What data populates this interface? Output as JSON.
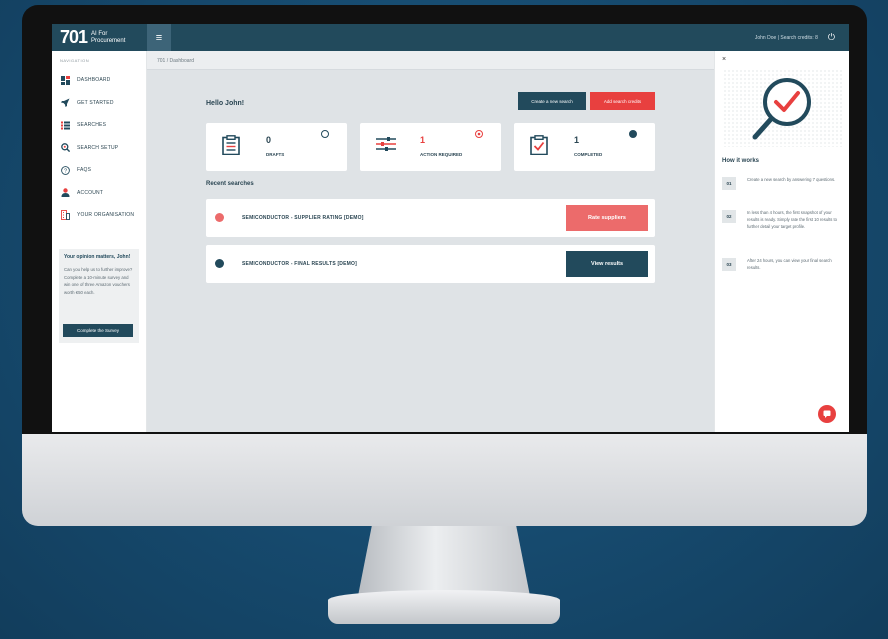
{
  "header": {
    "logo_number": "701",
    "logo_line1": "AI For",
    "logo_line2": "Procurement",
    "menu_icon": "hamburger-icon",
    "user_credits": "John Doe | Search credits: 8",
    "power_icon": "power-icon"
  },
  "sidebar": {
    "heading": "NAVIGATION",
    "items": [
      {
        "label": "DASHBOARD",
        "icon": "dashboard-icon"
      },
      {
        "label": "GET STARTED",
        "icon": "rocket-icon"
      },
      {
        "label": "SEARCHES",
        "icon": "list-icon"
      },
      {
        "label": "SEARCH SETUP",
        "icon": "search-settings-icon"
      },
      {
        "label": "FAQS",
        "icon": "question-icon"
      },
      {
        "label": "ACCOUNT",
        "icon": "user-icon"
      },
      {
        "label": "YOUR ORGANISATION",
        "icon": "building-icon"
      }
    ],
    "survey": {
      "title": "Your opinion matters, John!",
      "text": "Can you help us to further improve? Complete a 10-minute survey and win one of three Amazon vouchers worth €50 each.",
      "button": "Complete the Survey"
    }
  },
  "main": {
    "breadcrumb": "701 / Dashboard",
    "greeting": "Hello John!",
    "create_button": "Create a new search",
    "add_button": "Add search credits",
    "stats": [
      {
        "value": "0",
        "label": "DRAFTS",
        "icon": "clipboard-list-icon",
        "value_color": "#2b4653",
        "mark": "empty-circle"
      },
      {
        "value": "1",
        "label": "ACTION REQUIRED",
        "icon": "sliders-icon",
        "value_color": "#e8403f",
        "mark": "alert-circle"
      },
      {
        "value": "1",
        "label": "COMPLETED",
        "icon": "clipboard-check-icon",
        "value_color": "#2b4653",
        "mark": "filled-circle"
      }
    ],
    "recent_title": "Recent searches",
    "searches": [
      {
        "title": "SEMICONDUCTOR - SUPPLIER RATING [DEMO]",
        "button": "Rate suppliers",
        "dot_color": "#ec6b6b",
        "button_color": "#ec6b6b"
      },
      {
        "title": "SEMICONDUCTOR - FINAL RESULTS [DEMO]",
        "button": "View results",
        "dot_color": "#224a5c",
        "button_color": "#224a5c"
      }
    ]
  },
  "right_panel": {
    "close": "×",
    "how_title": "How it works",
    "steps": [
      {
        "num": "01",
        "text": "Create a new search by answering 7 questions."
      },
      {
        "num": "02",
        "text": "In less than 4 hours, the first snapshot of your results is ready. Simply rate the first 10 results to further detail your target profile."
      },
      {
        "num": "03",
        "text": "After 24 hours, you can view your final search results."
      }
    ],
    "chat_icon": "chat-icon"
  },
  "colors": {
    "primary": "#224a5c",
    "accent": "#e8403f",
    "soft_red": "#ec6b6b",
    "background": "#dfe3e6"
  }
}
